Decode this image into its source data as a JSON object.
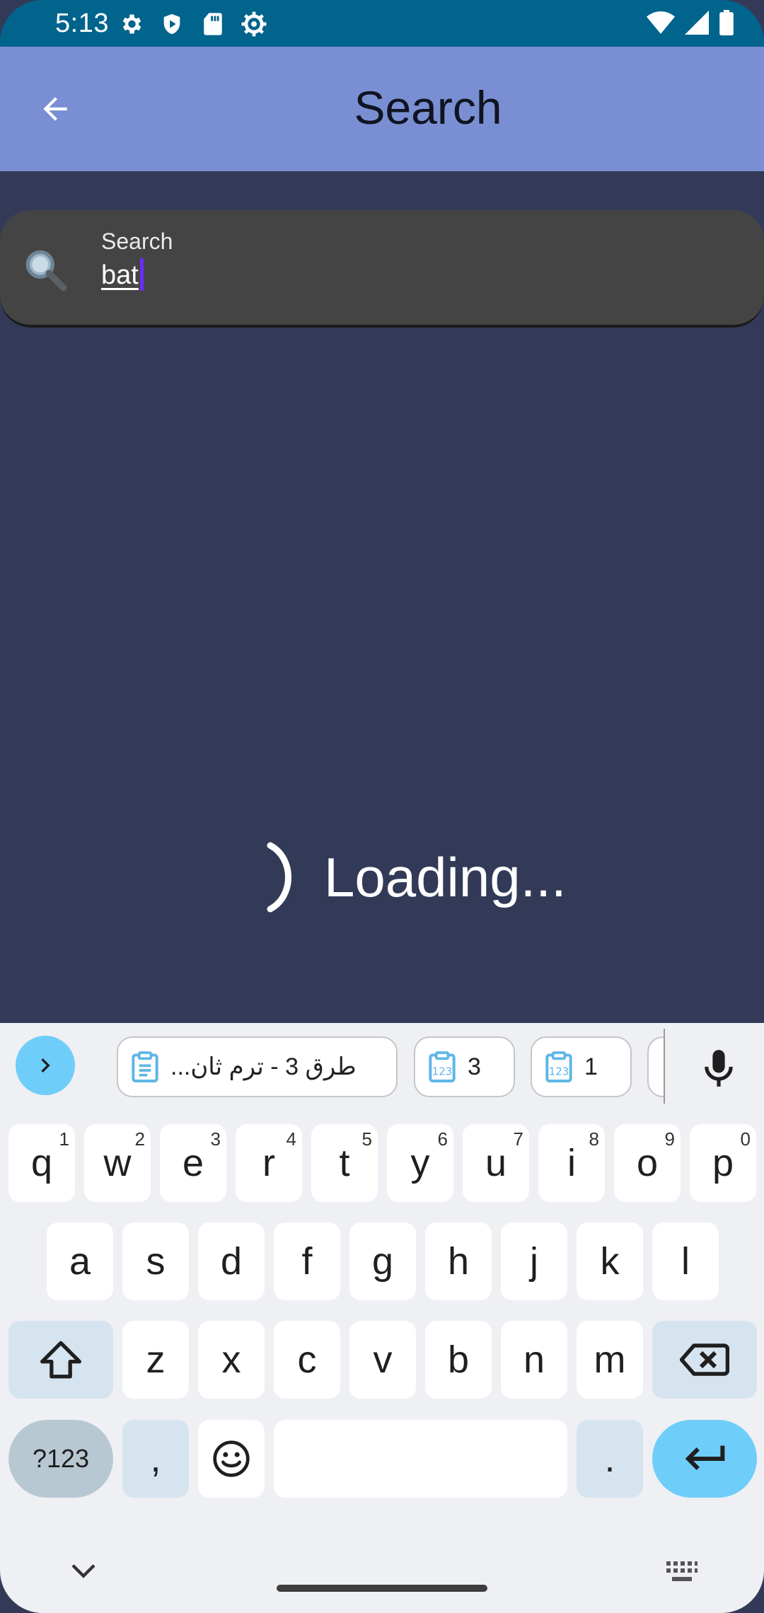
{
  "status_bar": {
    "time": "5:13",
    "left_icons": [
      "gear-icon",
      "shield-play-icon",
      "sd-card-icon",
      "settings-cog-icon"
    ],
    "right_icons": [
      "wifi-icon",
      "signal-icon",
      "battery-icon"
    ],
    "color": "#01648c"
  },
  "app_bar": {
    "title": "Search",
    "back_icon": "arrow-left-icon",
    "color": "#7a8fd3"
  },
  "search": {
    "label": "Search",
    "value": "bat",
    "icon": "magnifier-icon"
  },
  "loading": {
    "text": "Loading..."
  },
  "keyboard": {
    "suggestion_chips": [
      {
        "text": "طرق 3  - ترم ثان...",
        "icon": "clipboard-icon"
      },
      {
        "text": "3",
        "icon": "clipboard-123-icon"
      },
      {
        "text": "1",
        "icon": "clipboard-123-icon"
      }
    ],
    "row1": [
      {
        "key": "q",
        "hint": "1"
      },
      {
        "key": "w",
        "hint": "2"
      },
      {
        "key": "e",
        "hint": "3"
      },
      {
        "key": "r",
        "hint": "4"
      },
      {
        "key": "t",
        "hint": "5"
      },
      {
        "key": "y",
        "hint": "6"
      },
      {
        "key": "u",
        "hint": "7"
      },
      {
        "key": "i",
        "hint": "8"
      },
      {
        "key": "o",
        "hint": "9"
      },
      {
        "key": "p",
        "hint": "0"
      }
    ],
    "row2": [
      "a",
      "s",
      "d",
      "f",
      "g",
      "h",
      "j",
      "k",
      "l"
    ],
    "row3": [
      "z",
      "x",
      "c",
      "v",
      "b",
      "n",
      "m"
    ],
    "symbols_label": "?123",
    "comma": ",",
    "period": ".",
    "accent": "#6fcdf9"
  }
}
